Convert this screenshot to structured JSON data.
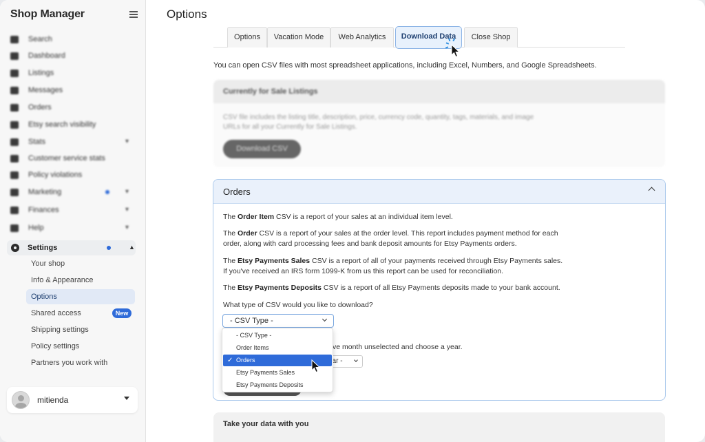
{
  "app": {
    "title": "Shop Manager"
  },
  "sidebar": {
    "items": [
      {
        "label": "Search",
        "icon": "search-icon"
      },
      {
        "label": "Dashboard",
        "icon": "home-icon"
      },
      {
        "label": "Listings",
        "icon": "tag-icon"
      },
      {
        "label": "Messages",
        "icon": "message-icon"
      },
      {
        "label": "Orders",
        "icon": "clipboard-icon"
      },
      {
        "label": "Etsy search visibility",
        "icon": "binoculars-icon"
      },
      {
        "label": "Stats",
        "icon": "bar-chart-icon"
      },
      {
        "label": "Customer service stats",
        "icon": "headset-icon"
      },
      {
        "label": "Policy violations",
        "icon": "flag-icon"
      },
      {
        "label": "Marketing",
        "icon": "megaphone-icon"
      },
      {
        "label": "Finances",
        "icon": "bank-icon"
      },
      {
        "label": "Help",
        "icon": "help-icon"
      }
    ],
    "settings": {
      "label": "Settings",
      "sub_items": [
        {
          "label": "Your shop"
        },
        {
          "label": "Info & Appearance"
        },
        {
          "label": "Options"
        },
        {
          "label": "Shared access"
        },
        {
          "label": "Shipping settings"
        },
        {
          "label": "Policy settings"
        },
        {
          "label": "Partners you work with"
        }
      ],
      "new_badge": "New"
    },
    "account": {
      "name": "mitienda"
    }
  },
  "main": {
    "title": "Options",
    "tabs": [
      {
        "label": "Options"
      },
      {
        "label": "Vacation Mode"
      },
      {
        "label": "Web Analytics"
      },
      {
        "label": "Download Data"
      },
      {
        "label": "Close Shop"
      }
    ],
    "intro": "You can open CSV files with most spreadsheet applications, including Excel, Numbers, and Google Spreadsheets.",
    "listings_card": {
      "title": "Currently for Sale Listings",
      "description": "CSV file includes the listing title, description, price, currency code, quantity, tags, materials, and image URLs for all your Currently for Sale Listings.",
      "button": "Download CSV"
    },
    "orders_card": {
      "title": "Orders",
      "p1_bold": "Order Item",
      "p1_pre": "The ",
      "p1_post": " CSV is a report of your sales at an individual item level.",
      "p2_pre": "The ",
      "p2_bold": "Order",
      "p2_post": " CSV is a report of your sales at the order level. This report includes payment method for each order, along with card processing fees and bank deposit amounts for Etsy Payments orders.",
      "p3_pre": "The ",
      "p3_bold": "Etsy Payments Sales",
      "p3_post": " CSV is a report of all of your payments received through Etsy Payments sales. If you've received an IRS form 1099-K from us this report can be used for reconciliation.",
      "p4_pre": "The ",
      "p4_bold": "Etsy Payments Deposits",
      "p4_post": " CSV is a report of all Etsy Payments deposits made to your bank account.",
      "question": "What type of CSV would you like to download?",
      "select_value": "- CSV Type -",
      "behind_text": "ve month unselected and choose a year.",
      "behind_select": "ear -",
      "dropdown_options": [
        {
          "label": "- CSV Type -"
        },
        {
          "label": "Order Items"
        },
        {
          "label": "Orders",
          "selected": true
        },
        {
          "label": "Etsy Payments Sales"
        },
        {
          "label": "Etsy Payments Deposits"
        }
      ],
      "check_mark": "✓"
    },
    "take_card": {
      "title": "Take your data with you"
    }
  },
  "colors": {
    "accent": "#2f6bd9",
    "active_tab_bg": "#e8f1fc",
    "card_border": "#a9c8ec"
  }
}
